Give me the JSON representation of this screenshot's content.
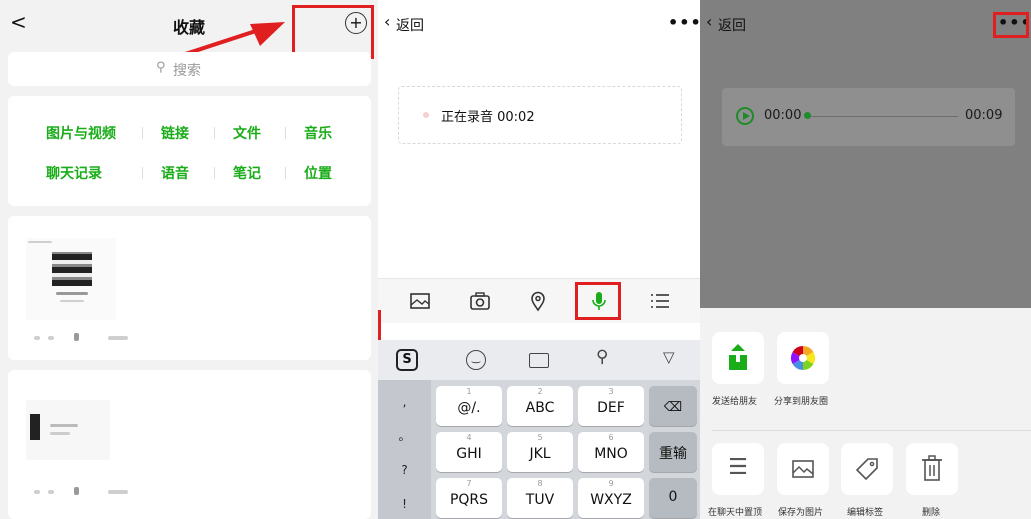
{
  "panel1": {
    "title": "收藏",
    "back_glyph": "<",
    "add_glyph": "+",
    "search_placeholder": "搜索",
    "categories_row1": [
      "图片与视频",
      "链接",
      "文件",
      "音乐"
    ],
    "categories_row2": [
      "聊天记录",
      "语音",
      "笔记",
      "位置"
    ],
    "accent_color": "#1aad19",
    "highlight_color": "#e02020"
  },
  "panel2": {
    "back_label": "返回",
    "more_glyph": "•••",
    "recording_text": "正在录音 00:02",
    "toolbar_icons": [
      "image-icon",
      "camera-icon",
      "location-icon",
      "microphone-icon",
      "list-icon"
    ],
    "keyboard": {
      "top_icons": [
        "sogou-logo-icon",
        "emoji-icon",
        "keyboard-icon",
        "search-icon",
        "collapse-icon"
      ],
      "symbols": [
        ",",
        "。",
        "?",
        "!"
      ],
      "rows": [
        [
          {
            "num": "1",
            "label": "@/."
          },
          {
            "num": "2",
            "label": "ABC"
          },
          {
            "num": "3",
            "label": "DEF"
          }
        ],
        [
          {
            "num": "4",
            "label": "GHI"
          },
          {
            "num": "5",
            "label": "JKL"
          },
          {
            "num": "6",
            "label": "MNO"
          }
        ],
        [
          {
            "num": "7",
            "label": "PQRS"
          },
          {
            "num": "8",
            "label": "TUV"
          },
          {
            "num": "9",
            "label": "WXYZ"
          }
        ]
      ],
      "retype_label": "重输",
      "zero_label": "0"
    }
  },
  "panel3": {
    "back_label": "返回",
    "more_glyph": "•••",
    "time_start": "00:00",
    "time_end": "00:09",
    "playback_progress": 0.0,
    "share_row": [
      {
        "label": "发送给朋友",
        "icon": "share-export-icon"
      },
      {
        "label": "分享到朋友圈",
        "icon": "moments-icon"
      }
    ],
    "action_row": [
      {
        "label": "在聊天中置顶",
        "icon": "pin-top-icon"
      },
      {
        "label": "保存为图片",
        "icon": "save-image-icon"
      },
      {
        "label": "编辑标签",
        "icon": "tag-icon"
      },
      {
        "label": "删除",
        "icon": "trash-icon"
      }
    ]
  }
}
